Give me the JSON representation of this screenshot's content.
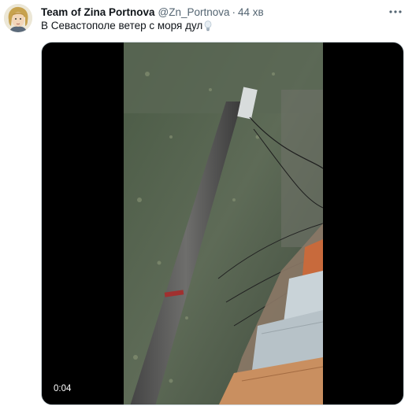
{
  "tweet": {
    "author_name": "Team of Zina Portnova",
    "handle": "@Zn_Portnova",
    "separator": "·",
    "time": "44 хв",
    "text": "В Севастополе ветер с моря дул",
    "emoji_icon": "light-bulb-icon"
  },
  "media": {
    "type": "video",
    "duration": "0:04"
  },
  "icons": {
    "more": "more-options-icon"
  }
}
